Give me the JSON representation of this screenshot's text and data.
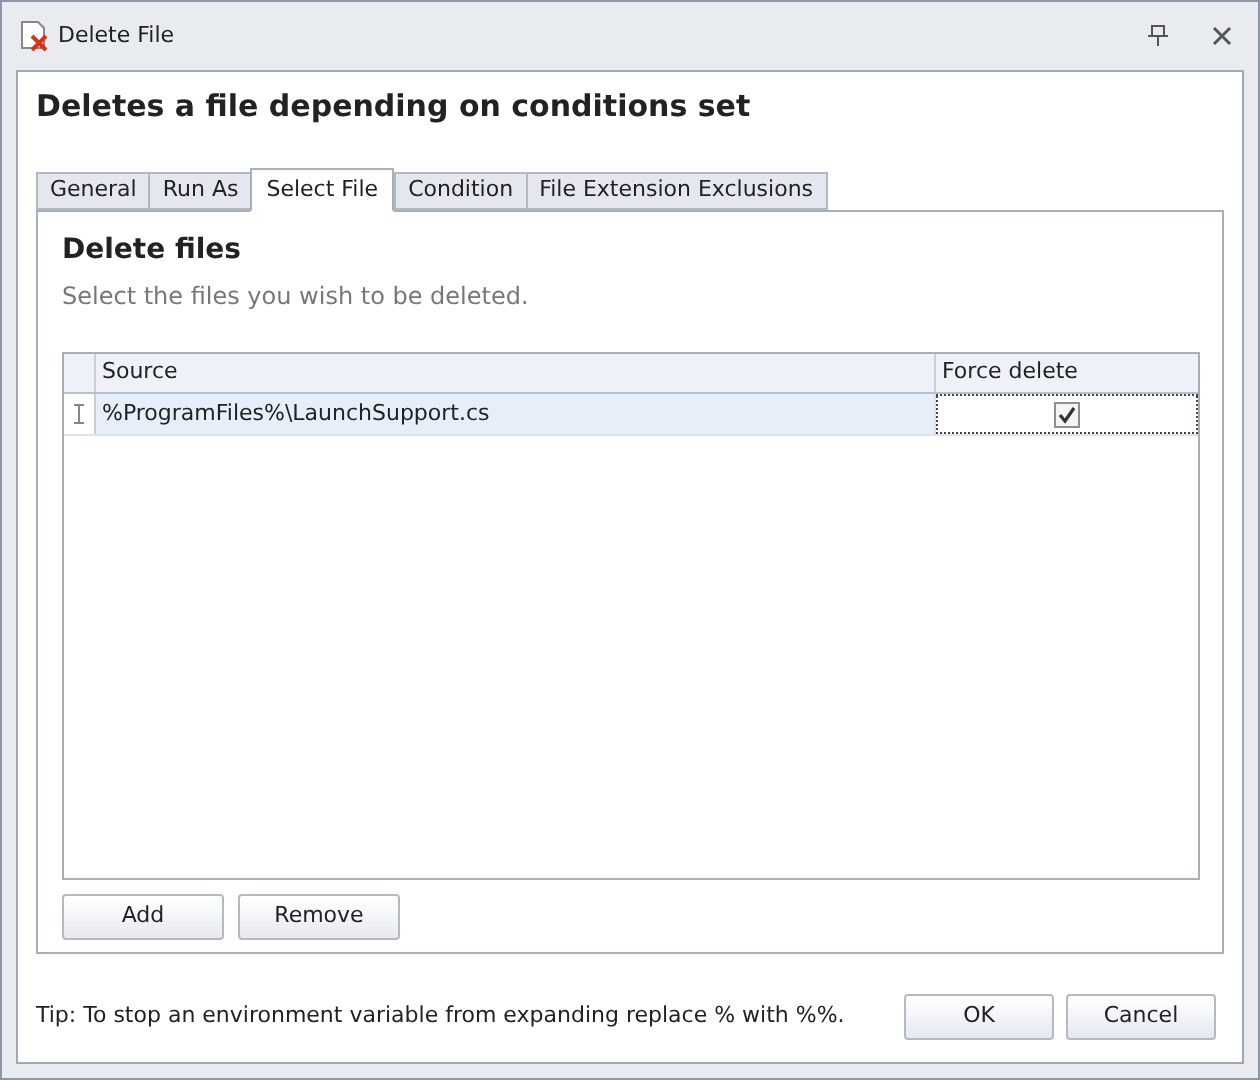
{
  "window": {
    "title": "Delete File"
  },
  "heading": "Deletes a file depending on conditions set",
  "tabs": [
    {
      "label": "General",
      "selected": false
    },
    {
      "label": "Run As",
      "selected": false
    },
    {
      "label": "Select File",
      "selected": true
    },
    {
      "label": "Condition",
      "selected": false
    },
    {
      "label": "File Extension Exclusions",
      "selected": false
    }
  ],
  "panel": {
    "title": "Delete files",
    "subtitle": "Select the files you wish to be deleted."
  },
  "table": {
    "columns": [
      "Source",
      "Force delete"
    ],
    "rows": [
      {
        "source": "%ProgramFiles%\\LaunchSupport.cs",
        "force_delete": true,
        "selected": true
      }
    ]
  },
  "table_buttons": [
    "Add",
    "Remove"
  ],
  "tip": "Tip: To stop an environment variable from expanding replace % with %%.",
  "buttons": [
    "OK",
    "Cancel"
  ]
}
